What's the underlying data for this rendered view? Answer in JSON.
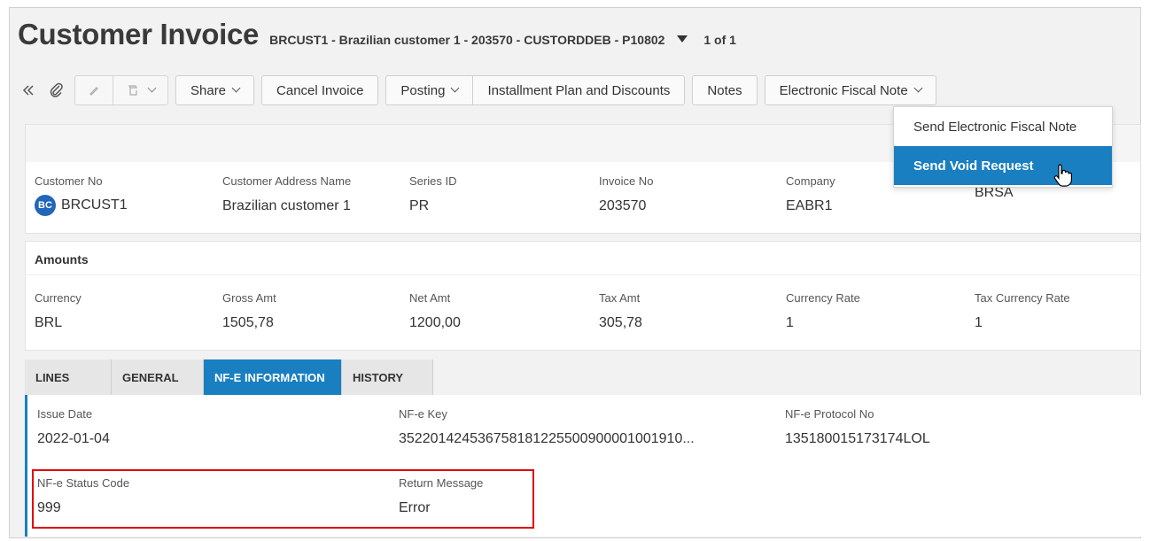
{
  "header": {
    "title": "Customer Invoice",
    "subtitle": "BRCUST1 - Brazilian customer 1 - 203570 - CUSTORDDEB - P10802",
    "pager": "1 of 1"
  },
  "toolbar": {
    "share_label": "Share",
    "cancel_label": "Cancel Invoice",
    "posting_label": "Posting",
    "installment_label": "Installment Plan and Discounts",
    "notes_label": "Notes",
    "efn_label": "Electronic Fiscal Note"
  },
  "menu": {
    "items": [
      "Send Electronic Fiscal Note",
      "Send Void Request"
    ]
  },
  "header_fields": [
    {
      "label": "Customer No",
      "value": "BRCUST1",
      "avatar": "BC"
    },
    {
      "label": "Customer Address Name",
      "value": "Brazilian customer 1"
    },
    {
      "label": "Series ID",
      "value": "PR"
    },
    {
      "label": "Invoice No",
      "value": "203570"
    },
    {
      "label": "Company",
      "value": "EABR1"
    },
    {
      "label": "",
      "value": "BRSA"
    }
  ],
  "amounts": {
    "title": "Amounts",
    "fields": [
      {
        "label": "Currency",
        "value": "BRL"
      },
      {
        "label": "Gross Amt",
        "value": "1505,78"
      },
      {
        "label": "Net Amt",
        "value": "1200,00"
      },
      {
        "label": "Tax Amt",
        "value": "305,78"
      },
      {
        "label": "Currency Rate",
        "value": "1"
      },
      {
        "label": "Tax Currency Rate",
        "value": "1"
      }
    ]
  },
  "tabs": [
    "LINES",
    "GENERAL",
    "NF-E INFORMATION",
    "HISTORY"
  ],
  "nfe": {
    "issue_date_label": "Issue Date",
    "issue_date": "2022-01-04",
    "key_label": "NF-e Key",
    "key": "352201424536758181225500900001001910...",
    "protocol_label": "NF-e Protocol No",
    "protocol": "135180015173174LOL",
    "status_label": "NF-e Status Code",
    "status": "999",
    "return_label": "Return Message",
    "return": "Error"
  }
}
